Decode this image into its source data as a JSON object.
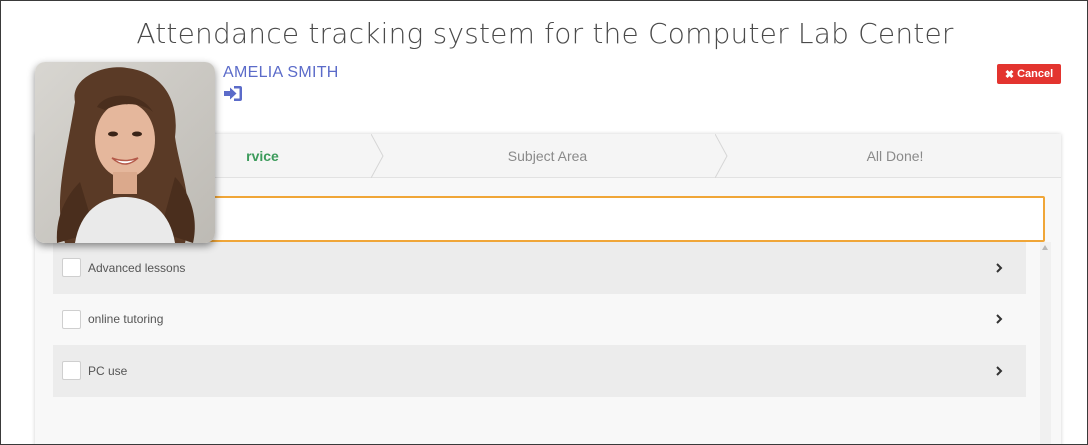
{
  "header": {
    "title": "Attendance tracking system for the Computer Lab Center",
    "user_name": "AMELIA SMITH",
    "signin_icon": "sign-in-icon",
    "cancel_label": "Cancel",
    "cancel_icon": "close-icon"
  },
  "wizard": {
    "steps": [
      {
        "label": "rvice",
        "active": true
      },
      {
        "label": "Subject Area",
        "active": false
      },
      {
        "label": "All Done!",
        "active": false
      }
    ],
    "search": {
      "value": "",
      "placeholder": ""
    },
    "items": [
      {
        "label": "Advanced lessons",
        "checked": false
      },
      {
        "label": "online tutoring",
        "checked": false
      },
      {
        "label": "PC use",
        "checked": false
      }
    ]
  },
  "colors": {
    "accent_user": "#5b6bc9",
    "cancel_bg": "#e3342f",
    "active_step": "#3c9b5b",
    "search_border": "#f0a638"
  }
}
